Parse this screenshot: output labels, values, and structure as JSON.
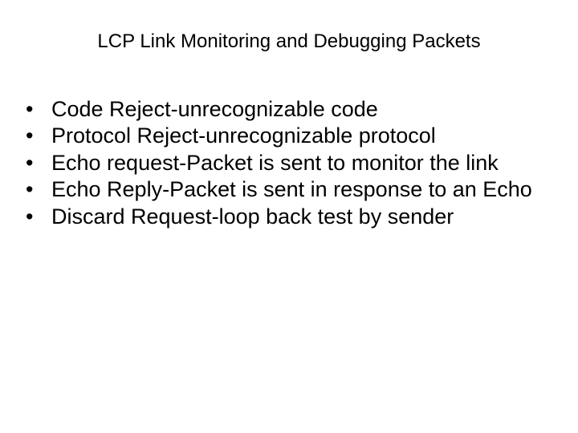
{
  "title": "LCP Link Monitoring and Debugging Packets",
  "bullets": [
    "Code Reject-unrecognizable code",
    "Protocol Reject-unrecognizable protocol",
    "Echo request-Packet is sent to monitor the link",
    "Echo Reply-Packet is sent in response to an Echo",
    "Discard Request-loop back test by sender"
  ]
}
